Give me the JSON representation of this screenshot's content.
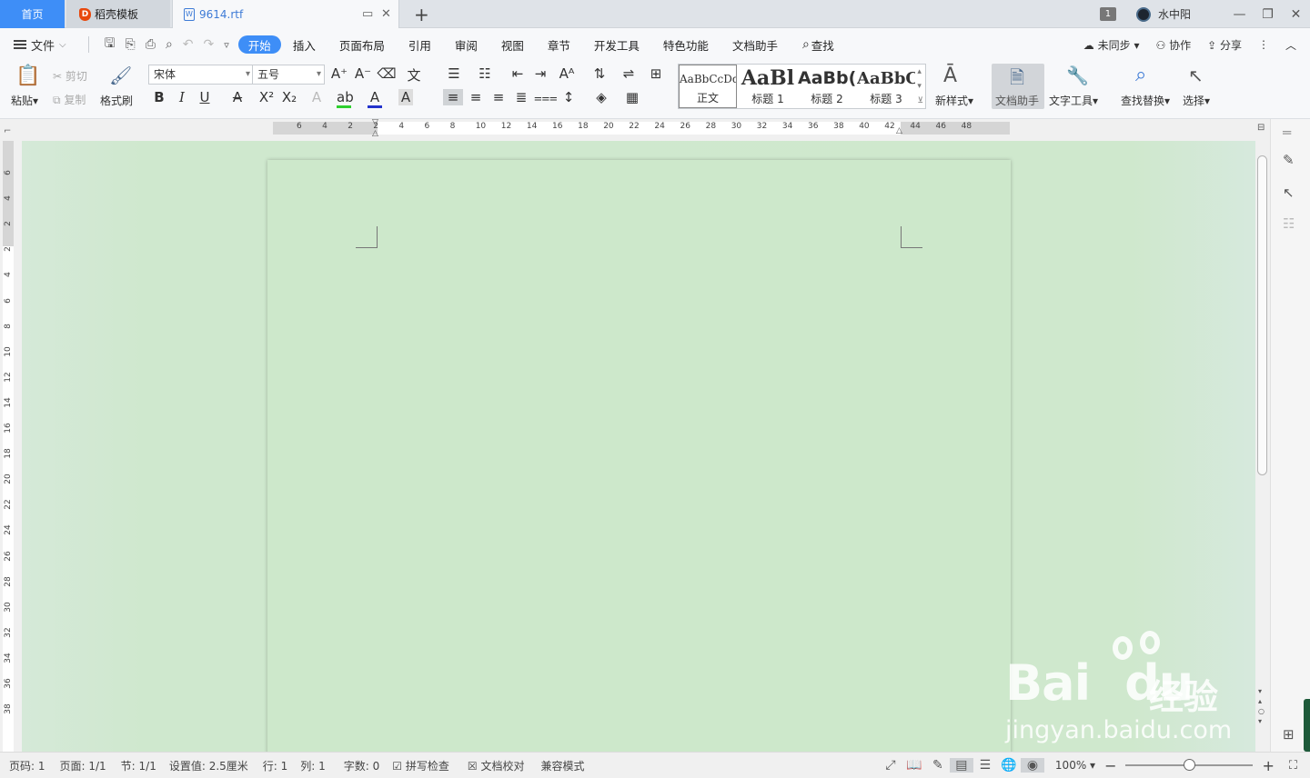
{
  "tabs": {
    "home": "首页",
    "daoke": "稻壳模板",
    "doc": "9614.rtf"
  },
  "titlebar": {
    "badge": "1",
    "user": "水中阳",
    "min": "—",
    "restore": "❐",
    "close": "✕"
  },
  "menu": {
    "file": "文件",
    "tabs": [
      "开始",
      "插入",
      "页面布局",
      "引用",
      "审阅",
      "视图",
      "章节",
      "开发工具",
      "特色功能",
      "文档助手"
    ],
    "search": "查找",
    "sync": "未同步",
    "collab": "协作",
    "share": "分享"
  },
  "ribbon": {
    "paste": "粘贴",
    "cut": "剪切",
    "copy": "复制",
    "format_painter": "格式刷",
    "font_name": "宋体",
    "font_size": "五号",
    "styles": [
      {
        "preview": "AaBbCcDd",
        "name": "正文"
      },
      {
        "preview": "AaBl",
        "name": "标题 1"
      },
      {
        "preview": "AaBb(",
        "name": "标题 2"
      },
      {
        "preview": "AaBbC",
        "name": "标题 3"
      }
    ],
    "new_style": "新样式",
    "doc_assistant": "文档助手",
    "text_tools": "文字工具",
    "find_replace": "查找替换",
    "select": "选择"
  },
  "ruler": {
    "h_ticks": [
      "6",
      "4",
      "2",
      "2",
      "4",
      "6",
      "8",
      "10",
      "12",
      "14",
      "16",
      "18",
      "20",
      "22",
      "24",
      "26",
      "28",
      "30",
      "32",
      "34",
      "36",
      "38",
      "40",
      "42",
      "44",
      "46",
      "48"
    ],
    "v_ticks": [
      "6",
      "4",
      "2",
      "2",
      "4",
      "6",
      "8",
      "10",
      "12",
      "14",
      "16",
      "18",
      "20",
      "22",
      "24",
      "26",
      "28",
      "30",
      "32",
      "34",
      "36",
      "38"
    ]
  },
  "status": {
    "page_num": "页码: 1",
    "pages": "页面: 1/1",
    "section": "节: 1/1",
    "setting": "设置值: 2.5厘米",
    "row": "行: 1",
    "col": "列: 1",
    "words": "字数: 0",
    "spell": "拼写检查",
    "proof": "文档校对",
    "compat": "兼容模式",
    "zoom": "100%"
  },
  "watermark": {
    "logo": "Bai",
    "logo2": "du",
    "cn": "经验",
    "url": "jingyan.baidu.com"
  },
  "colors": {
    "accent": "#3e8ef7",
    "doc_bg": "#cfe8cd"
  }
}
